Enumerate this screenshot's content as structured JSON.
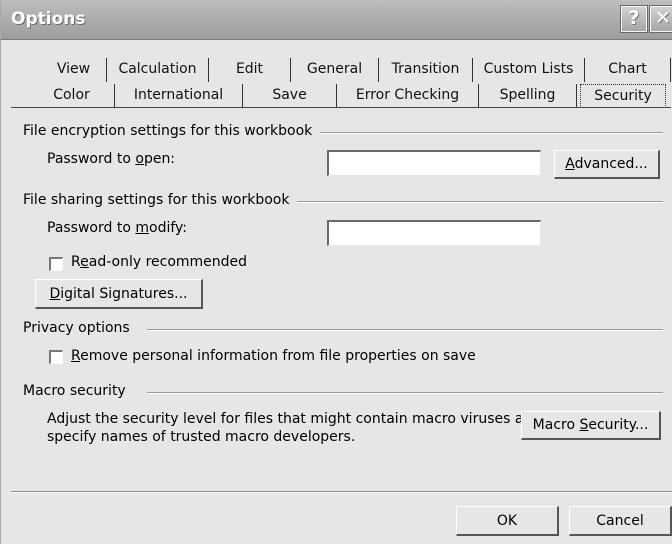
{
  "window": {
    "title": "Options",
    "help_glyph": "?",
    "close_glyph": "✕"
  },
  "tabs": {
    "row1": [
      "View",
      "Calculation",
      "Edit",
      "General",
      "Transition",
      "Custom Lists",
      "Chart"
    ],
    "row2": [
      "Color",
      "International",
      "Save",
      "Error Checking",
      "Spelling",
      "Security"
    ],
    "selected": "Security"
  },
  "encryption": {
    "section_label": "File encryption settings for this workbook",
    "password_open_prefix": "Password to ",
    "password_open_key": "o",
    "password_open_suffix": "pen:",
    "password_open_value": "",
    "advanced_key": "A",
    "advanced_rest": "dvanced..."
  },
  "sharing": {
    "section_label": "File sharing settings for this workbook",
    "password_modify_prefix": "Password to ",
    "password_modify_key": "m",
    "password_modify_suffix": "odify:",
    "password_modify_value": "",
    "readonly_prefix": "R",
    "readonly_key": "e",
    "readonly_suffix": "ad-only recommended",
    "readonly_checked": false,
    "digsig_key": "D",
    "digsig_rest": "igital Signatures..."
  },
  "privacy": {
    "section_label": "Privacy options",
    "remove_key": "R",
    "remove_rest": "emove personal information from file properties on save",
    "remove_checked": false
  },
  "macro": {
    "section_label": "Macro security",
    "description_line1": "Adjust the security level for files that might contain macro viruses and",
    "description_line2": "specify names of trusted macro developers.",
    "button_prefix": "Macro ",
    "button_key": "S",
    "button_suffix": "ecurity..."
  },
  "footer": {
    "ok_label": "OK",
    "cancel_label": "Cancel"
  }
}
